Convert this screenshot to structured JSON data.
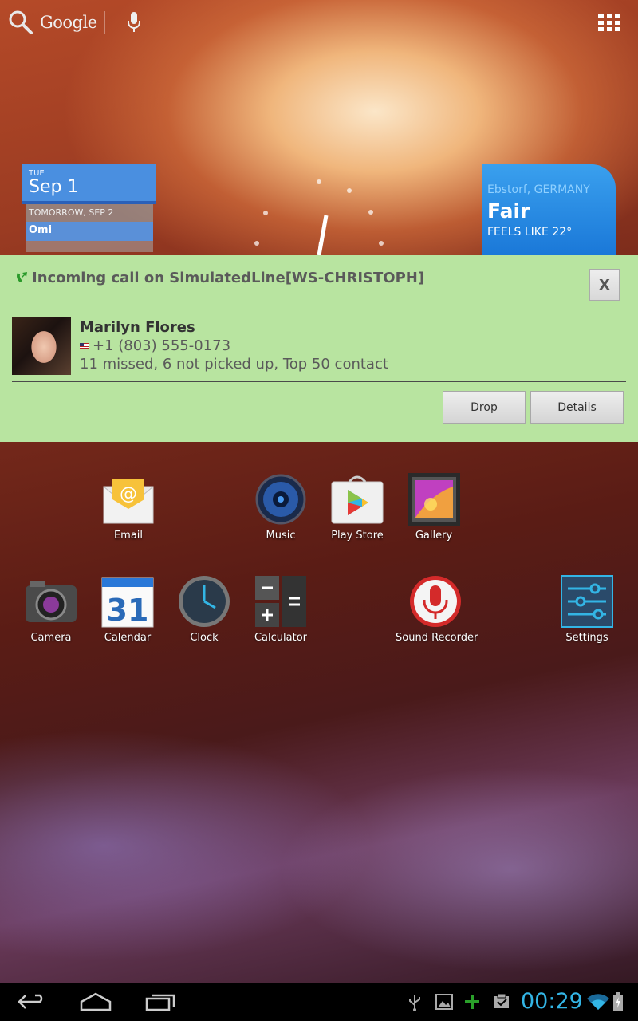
{
  "search": {
    "label": "Google"
  },
  "calendar": {
    "day": "TUE",
    "date": "Sep 1",
    "tomorrow": "TOMORROW, SEP 2",
    "event": "Omi"
  },
  "weather": {
    "location": "Ebstorf, GERMANY",
    "condition": "Fair",
    "feels_like": "FEELS LIKE 22°"
  },
  "notification": {
    "title": "Incoming call on SimulatedLine[WS-CHRISTOPH]",
    "close_label": "X",
    "caller_name": "Marilyn Flores",
    "caller_phone": "+1 (803) 555-0173",
    "caller_info": "11 missed, 6 not picked up, Top 50 contact",
    "drop_label": "Drop",
    "details_label": "Details",
    "bg_color": "#b8e4a0"
  },
  "apps_row1": [
    {
      "label": "Email",
      "icon": "email-icon"
    },
    {
      "label": "Music",
      "icon": "music-icon"
    },
    {
      "label": "Play Store",
      "icon": "play-store-icon"
    },
    {
      "label": "Gallery",
      "icon": "gallery-icon"
    }
  ],
  "apps_row2": [
    {
      "label": "Camera",
      "icon": "camera-icon"
    },
    {
      "label": "Calendar",
      "icon": "calendar-icon"
    },
    {
      "label": "Clock",
      "icon": "clock-icon"
    },
    {
      "label": "Calculator",
      "icon": "calculator-icon"
    },
    {
      "label": "Sound Recorder",
      "icon": "sound-recorder-icon"
    },
    {
      "label": "Settings",
      "icon": "settings-icon"
    }
  ],
  "calendar_icon_number": "31",
  "status_bar": {
    "time": "00:29",
    "accent": "#33b5e5"
  }
}
